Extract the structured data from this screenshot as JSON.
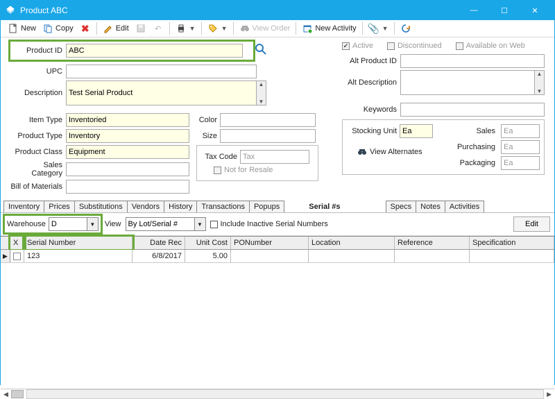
{
  "window": {
    "title": "Product ABC"
  },
  "toolbar": {
    "new": "New",
    "copy": "Copy",
    "edit": "Edit",
    "view_order": "View Order",
    "new_activity": "New Activity"
  },
  "form": {
    "product_id_label": "Product ID",
    "product_id": "ABC",
    "upc_label": "UPC",
    "upc": "",
    "desc_label": "Description",
    "desc": "Test Serial Product",
    "item_type_label": "Item Type",
    "item_type": "Inventoried",
    "product_type_label": "Product Type",
    "product_type": "Inventory",
    "product_class_label": "Product Class",
    "product_class": "Equipment",
    "sales_cat_label": "Sales Category",
    "sales_cat": "",
    "bom_label": "Bill of Materials",
    "bom": "",
    "color_label": "Color",
    "color": "",
    "size_label": "Size",
    "size": "",
    "tax_code_label": "Tax Code",
    "tax_code": "Tax",
    "not_for_resale": "Not for Resale",
    "active": "Active",
    "discontinued": "Discontinued",
    "avail_web": "Available on Web",
    "alt_pid_label": "Alt Product ID",
    "alt_pid": "",
    "alt_desc_label": "Alt Description",
    "alt_desc": "",
    "keywords_label": "Keywords",
    "keywords": "",
    "stocking_unit_label": "Stocking Unit",
    "stocking_unit": "Ea",
    "view_alternates": "View Alternates",
    "sales_u_label": "Sales",
    "sales_u": "Ea",
    "purchasing_u_label": "Purchasing",
    "purchasing_u": "Ea",
    "packaging_u_label": "Packaging",
    "packaging_u": "Ea"
  },
  "tabs": {
    "inventory": "Inventory",
    "prices": "Prices",
    "subs": "Substitutions",
    "vendors": "Vendors",
    "history": "History",
    "trans": "Transactions",
    "popups": "Popups",
    "serials": "Serial #s",
    "specs": "Specs",
    "notes": "Notes",
    "activities": "Activities"
  },
  "subtool": {
    "warehouse_label": "Warehouse",
    "warehouse": "D",
    "view_label": "View",
    "view": "By Lot/Serial #",
    "include_inactive": "Include Inactive Serial Numbers",
    "edit": "Edit"
  },
  "grid": {
    "cols": {
      "x": "X",
      "serial": "Serial Number",
      "date": "Date Rec",
      "cost": "Unit Cost",
      "po": "PONumber",
      "loc": "Location",
      "ref": "Reference",
      "spec": "Specification"
    },
    "rows": [
      {
        "x": "",
        "serial": "123",
        "date": "6/8/2017",
        "cost": "5.00",
        "po": "",
        "loc": "",
        "ref": "",
        "spec": ""
      }
    ]
  }
}
